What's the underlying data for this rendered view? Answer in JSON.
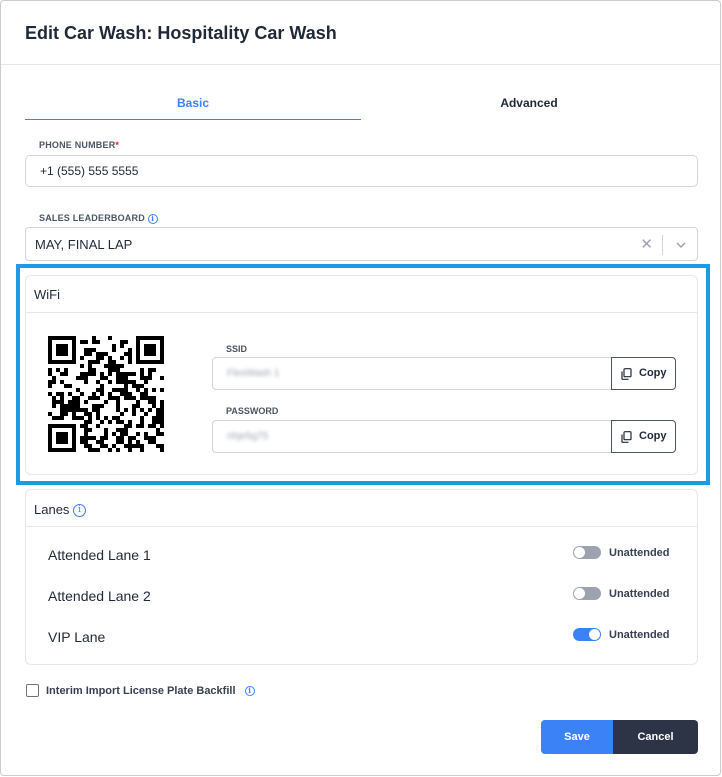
{
  "modal": {
    "title": "Edit Car Wash: Hospitality Car Wash"
  },
  "tabs": [
    {
      "label": "Basic",
      "active": true
    },
    {
      "label": "Advanced",
      "active": false
    }
  ],
  "phone": {
    "label": "PHONE NUMBER",
    "required_mark": "*",
    "value": "+1 (555) 555 5555"
  },
  "leaderboard": {
    "label": "SALES LEADERBOARD",
    "value": "MAY, FINAL LAP",
    "clear_glyph": "✕"
  },
  "wifi": {
    "title": "WiFi",
    "ssid": {
      "label": "SSID",
      "value": "FlexWash 1",
      "copy_label": "Copy"
    },
    "password": {
      "label": "PASSWORD",
      "value": "nhje5g75",
      "copy_label": "Copy"
    }
  },
  "lanes": {
    "title": "Lanes",
    "items": [
      {
        "name": "Attended Lane 1",
        "toggle_label": "Unattended",
        "on": false
      },
      {
        "name": "Attended Lane 2",
        "toggle_label": "Unattended",
        "on": false
      },
      {
        "name": "VIP Lane",
        "toggle_label": "Unattended",
        "on": true
      }
    ]
  },
  "backfill": {
    "label": "Interim Import License Plate Backfill",
    "checked": false
  },
  "actions": {
    "save_label": "Save",
    "cancel_label": "Cancel"
  },
  "colors": {
    "accent": "#3b82f6",
    "highlight": "#1e9be5",
    "cancel_bg": "#2d3446"
  },
  "icons": {
    "info": "info-circle-icon",
    "copy": "copy-icon",
    "dropdown": "chevron-down-icon",
    "clear": "clear-x-icon"
  }
}
